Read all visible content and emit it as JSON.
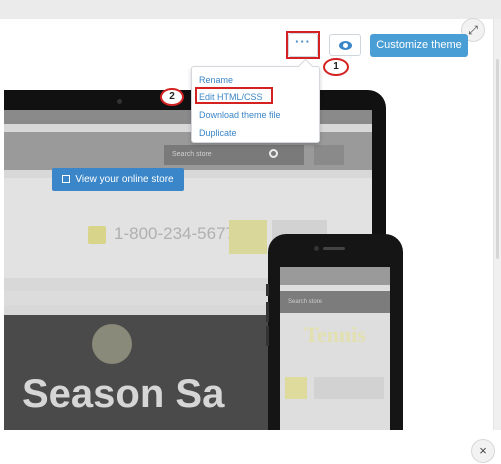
{
  "toolbar": {
    "more_label": "···",
    "preview_icon": "eye-icon",
    "customize_label": "Customize theme",
    "fullscreen_icon": "expand-icon"
  },
  "menu": {
    "items": [
      {
        "label": "Rename"
      },
      {
        "label": "Edit HTML/CSS"
      },
      {
        "label": "Download theme file"
      },
      {
        "label": "Duplicate"
      }
    ]
  },
  "callouts": {
    "one": "1",
    "two": "2"
  },
  "preview": {
    "search_placeholder": "Search store",
    "phone_number": "1-800-234-5677",
    "view_store_label": "View your online store",
    "hero_text": "Season Sa",
    "phone_logo": "Tennis"
  },
  "close_label": "×",
  "colors": {
    "accent": "#4a9ed6",
    "link": "#3a86c8",
    "highlight": "#d42222"
  }
}
